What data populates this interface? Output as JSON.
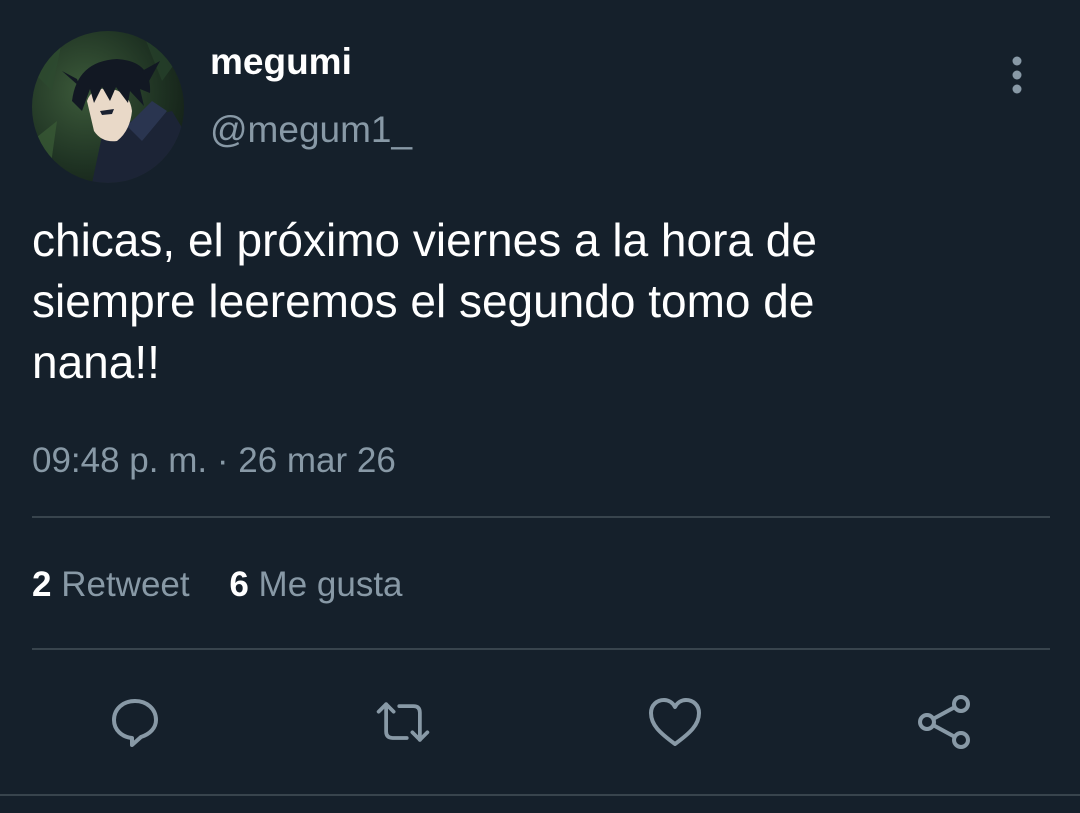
{
  "author": {
    "display_name": "megumi",
    "handle": "@megum1_"
  },
  "tweet": {
    "text": "chicas, el próximo viernes a la hora de\nsiempre leeremos el segundo tomo de\nnana!!",
    "time": "09:48 p. m.",
    "separator": "·",
    "date": "26 mar 26"
  },
  "stats": {
    "retweets_count": "2",
    "retweets_label": "Retweet",
    "likes_count": "6",
    "likes_label": "Me gusta"
  },
  "icons": {
    "more": "more-vertical-icon",
    "reply": "reply-bubble-icon",
    "retweet": "retweet-icon",
    "like": "heart-icon",
    "share": "share-icon"
  },
  "colors": {
    "background": "#15202b",
    "primary_text": "#ffffff",
    "secondary_text": "#8899a6",
    "divider": "#38444d"
  }
}
